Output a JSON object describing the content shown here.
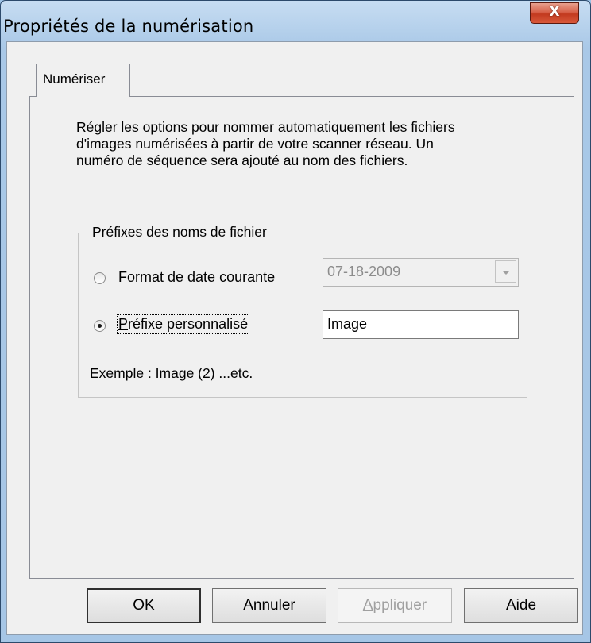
{
  "window": {
    "title": "Propriétés de la numérisation",
    "close_label": "X"
  },
  "tabs": [
    {
      "label": "Numériser",
      "selected": true
    }
  ],
  "description": [
    "Régler les options pour nommer automatiquement les fichiers",
    "d'images numérisées à partir de votre scanner réseau. Un",
    "numéro de séquence sera ajouté au nom des fichiers."
  ],
  "prefix_group": {
    "label": "Préfixes des noms de fichier",
    "date_option": {
      "mnemonic": "F",
      "rest": "ormat de date courante",
      "selected": false
    },
    "date_value": "07-18-2009",
    "custom_option": {
      "mnemonic": "P",
      "rest": "réfixe personnalisé",
      "selected": true
    },
    "custom_value": "Image",
    "example": "Exemple : Image (2) ...etc."
  },
  "buttons": {
    "ok": "OK",
    "cancel": "Annuler",
    "apply": {
      "mnemonic": "A",
      "rest": "ppliquer",
      "enabled": false
    },
    "help": "Aide"
  }
}
